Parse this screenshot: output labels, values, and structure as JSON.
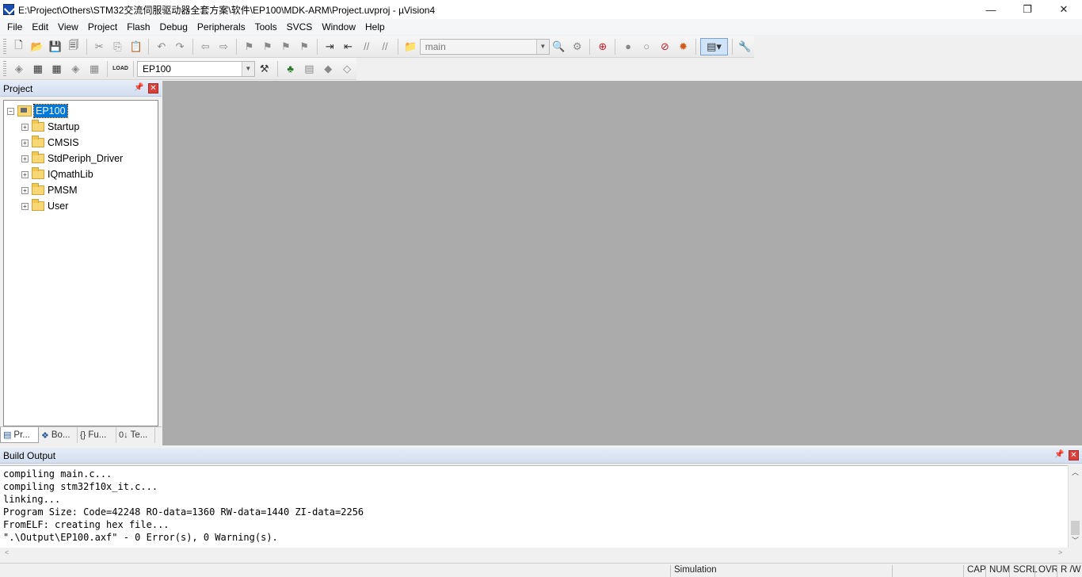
{
  "window": {
    "title": "E:\\Project\\Others\\STM32交流伺服驱动器全套方案\\软件\\EP100\\MDK-ARM\\Project.uvproj - µVision4",
    "minimize": "—",
    "maximize": "❐",
    "close": "✕"
  },
  "menu": [
    {
      "label": "File"
    },
    {
      "label": "Edit"
    },
    {
      "label": "View"
    },
    {
      "label": "Project"
    },
    {
      "label": "Flash"
    },
    {
      "label": "Debug"
    },
    {
      "label": "Peripherals"
    },
    {
      "label": "Tools"
    },
    {
      "label": "SVCS"
    },
    {
      "label": "Window"
    },
    {
      "label": "Help"
    }
  ],
  "toolbar1": {
    "find_combo_value": "main"
  },
  "toolbar2": {
    "target_combo_value": "EP100",
    "load_label": "LOAD"
  },
  "project_panel": {
    "title": "Project",
    "root": "EP100",
    "groups": [
      "Startup",
      "CMSIS",
      "StdPeriph_Driver",
      "IQmathLib",
      "PMSM",
      "User"
    ],
    "tabs": [
      "Pr...",
      "Bo...",
      "Fu...",
      "Te..."
    ]
  },
  "build_output": {
    "title": "Build Output",
    "lines": [
      "compiling main.c...",
      "compiling stm32f10x_it.c...",
      "linking...",
      "Program Size: Code=42248 RO-data=1360 RW-data=1440 ZI-data=2256",
      "FromELF: creating hex file...",
      "\".\\Output\\EP100.axf\" - 0 Error(s), 0 Warning(s)."
    ]
  },
  "statusbar": {
    "mode": "Simulation",
    "cap": "CAP",
    "num": "NUM",
    "scrl": "SCRL",
    "ovr": "OVR",
    "rw": "R /W"
  },
  "colors": {
    "editor_background": "#ababab",
    "selection": "#0078d7",
    "close_button": "#d9403a"
  }
}
